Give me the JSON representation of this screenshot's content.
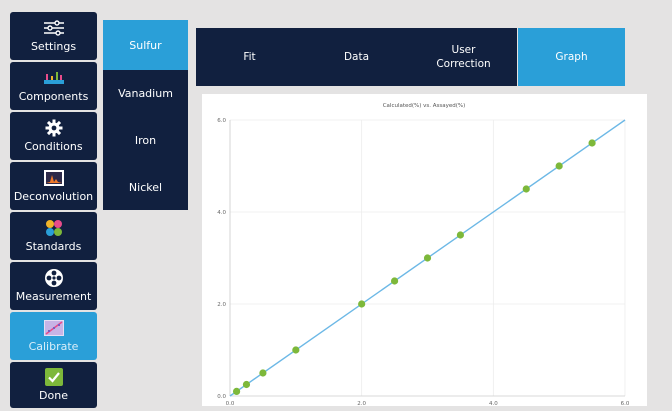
{
  "nav": {
    "items": [
      {
        "label": "Settings",
        "icon": "sliders-icon"
      },
      {
        "label": "Components",
        "icon": "spectrum-icon"
      },
      {
        "label": "Conditions",
        "icon": "gear-icon"
      },
      {
        "label": "Deconvolution",
        "icon": "peak-chart-icon"
      },
      {
        "label": "Standards",
        "icon": "standards-dots-icon"
      },
      {
        "label": "Measurement",
        "icon": "aperture-icon"
      },
      {
        "label": "Calibrate",
        "icon": "calibration-icon",
        "active": true
      },
      {
        "label": "Done",
        "icon": "checkmark-icon"
      }
    ]
  },
  "elements": {
    "items": [
      "Sulfur",
      "Vanadium",
      "Iron",
      "Nickel"
    ],
    "selected": "Sulfur"
  },
  "tabs": {
    "fit": "Fit",
    "data": "Data",
    "user_correction_line1": "User",
    "user_correction_line2": "Correction",
    "graph": "Graph",
    "active": "Graph"
  },
  "colors": {
    "nav_bg": "#11203f",
    "accent": "#2a9fd8",
    "line": "#6cb8e6",
    "points": "#7db83a"
  },
  "chart_data": {
    "type": "scatter",
    "title": "Calculated(%) vs. Assayed(%)",
    "x_ticks": [
      "0.0",
      "2.0",
      "4.0",
      "6.0"
    ],
    "y_ticks": [
      "0.0",
      "2.0",
      "4.0",
      "6.0"
    ],
    "xlim": [
      0,
      6
    ],
    "ylim": [
      0,
      6
    ],
    "grid": true,
    "fit_line": {
      "from": [
        0,
        0
      ],
      "to": [
        6,
        6
      ]
    },
    "points": [
      {
        "x": 0.1,
        "y": 0.1
      },
      {
        "x": 0.25,
        "y": 0.25
      },
      {
        "x": 0.5,
        "y": 0.5
      },
      {
        "x": 1.0,
        "y": 1.0
      },
      {
        "x": 2.0,
        "y": 2.0
      },
      {
        "x": 2.5,
        "y": 2.5
      },
      {
        "x": 3.0,
        "y": 3.0
      },
      {
        "x": 3.5,
        "y": 3.5
      },
      {
        "x": 4.5,
        "y": 4.5
      },
      {
        "x": 5.0,
        "y": 5.0
      },
      {
        "x": 5.5,
        "y": 5.5
      }
    ]
  }
}
